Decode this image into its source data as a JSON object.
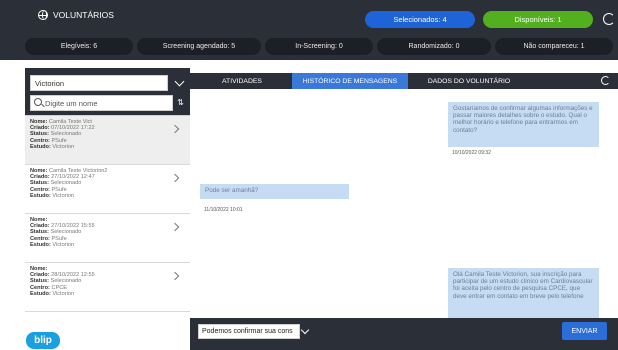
{
  "header": {
    "title": "VOLUNTÁRIOS",
    "pill_blue": "Selecionados: 4",
    "pill_green": "Disponíveis: 1",
    "stats": [
      {
        "label": "Elegíveis: 6"
      },
      {
        "label": "Screening agendado: 5"
      },
      {
        "label": "In-Screening: 0"
      },
      {
        "label": "Randomizado: 0"
      },
      {
        "label": "Não compareceu: 1"
      }
    ]
  },
  "sidebar": {
    "select_value": "Victorion",
    "search_placeholder": "Digite um nome",
    "items": [
      {
        "nome_label": "Nome:",
        "nome": "Camila Teste Vict",
        "criado_label": "Criado:",
        "criado": "07/10/2022 17:22",
        "status_label": "Status:",
        "status": "Selecionado",
        "centro_label": "Centro:",
        "centro": "PSufe",
        "estudo_label": "Estudo:",
        "estudo": "Victorion"
      },
      {
        "nome_label": "Nome:",
        "nome": "Camila Teste Victorion2",
        "criado_label": "Criado:",
        "criado": "27/10/2022 12:47",
        "status_label": "Status:",
        "status": "Selecionado",
        "centro_label": "Centro:",
        "centro": "PSufe",
        "estudo_label": "Estudo:",
        "estudo": "Victorion"
      },
      {
        "nome_label": "Nome:",
        "nome": "",
        "criado_label": "Criado:",
        "criado": "27/10/2022 15:55",
        "status_label": "Status:",
        "status": "Selecionado",
        "centro_label": "Centro:",
        "centro": "PSufe",
        "estudo_label": "Estudo:",
        "estudo": "Victorion"
      },
      {
        "nome_label": "Nome:",
        "nome": "",
        "criado_label": "Criado:",
        "criado": "28/10/2022 12:55",
        "status_label": "Status:",
        "status": "Selecionado",
        "centro_label": "Centro:",
        "centro": "CPCE",
        "estudo_label": "Estudo:",
        "estudo": "Victorion"
      }
    ]
  },
  "tabs": [
    {
      "label": "ATIVIDADES"
    },
    {
      "label": "HISTÓRICO DE MENSAGENS"
    },
    {
      "label": "DADOS DO VOLUNTÁRIO"
    }
  ],
  "chat": {
    "messages": [
      {
        "text": "Gostaríamos de confirmar algumas informações e passar maiores detalhes sobre o estudo. Qual o melhor horário e telefone para entrarmos em contato?",
        "time": "10/10/2022 09:32"
      },
      {
        "text": "Pode ser amanhã?",
        "time": "11/10/2022 10:01"
      },
      {
        "text": "Olá Camila Teste Victorion, sua inscrição para participar de um estudo clínico em Cardiovascular foi aceita pelo centro de pesquisa CPCE, que deve entrar em contato em breve pelo telefone",
        "time": ""
      }
    ]
  },
  "footer": {
    "input_value": "Podemos confirmar sua cons",
    "send_label": "ENVIAR"
  },
  "brand": {
    "logo_text": "blip",
    "colors": {
      "dark": "#2b2f38",
      "blue": "#1e63d8",
      "green": "#52b01f",
      "bubble": "#c5dcf2",
      "logo": "#1a9fe0"
    }
  }
}
